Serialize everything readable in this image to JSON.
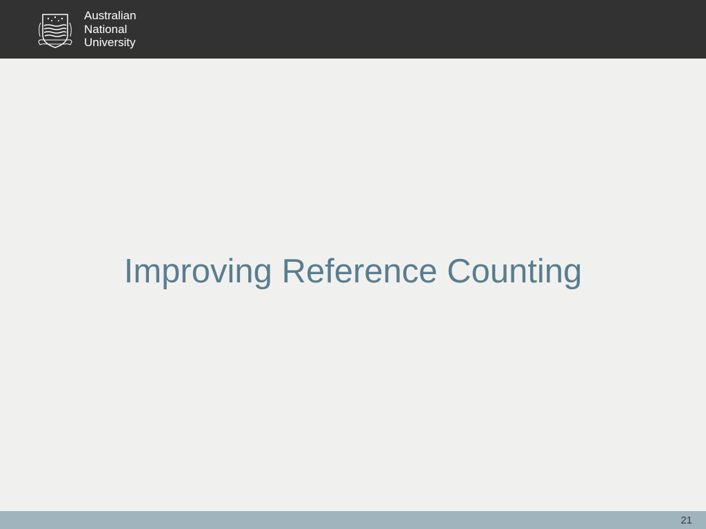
{
  "header": {
    "institution": {
      "line1": "Australian",
      "line2": "National",
      "line3": "University"
    }
  },
  "main": {
    "title": "Improving Reference Counting"
  },
  "footer": {
    "page_number": "21"
  },
  "colors": {
    "header_bg": "#323232",
    "body_bg": "#f0f1ef",
    "title_color": "#5a7d8e",
    "footer_bg": "#9fb4bd"
  }
}
